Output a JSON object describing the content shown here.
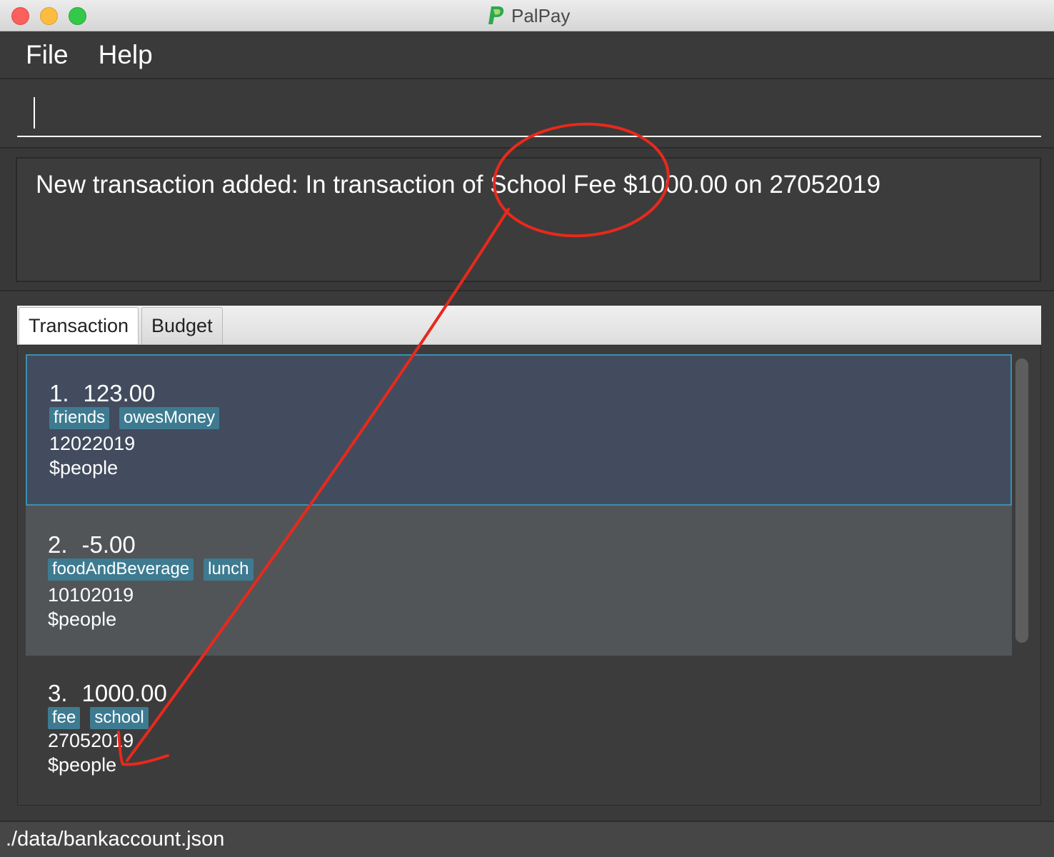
{
  "window": {
    "title": "PalPay"
  },
  "menu": {
    "file": "File",
    "help": "Help"
  },
  "command": {
    "value": ""
  },
  "result": {
    "message": "New transaction added: In transaction of School Fee $1000.00 on 27052019"
  },
  "tabs": [
    {
      "label": "Transaction"
    },
    {
      "label": "Budget"
    }
  ],
  "transactions": [
    {
      "index": "1.",
      "amount": "123.00",
      "tags": [
        "friends",
        "owesMoney"
      ],
      "date": "12022019",
      "description": "$people"
    },
    {
      "index": "2.",
      "amount": "-5.00",
      "tags": [
        "foodAndBeverage",
        "lunch"
      ],
      "date": "10102019",
      "description": "$people"
    },
    {
      "index": "3.",
      "amount": "1000.00",
      "tags": [
        "fee",
        "school"
      ],
      "date": "27052019",
      "description": "$people"
    }
  ],
  "status": {
    "path": "./data/bankaccount.json"
  },
  "colors": {
    "accent": "#3a8fb2",
    "tag": "#3e7b91",
    "annotation": "#e8291c",
    "logo": "#2fa84f"
  }
}
